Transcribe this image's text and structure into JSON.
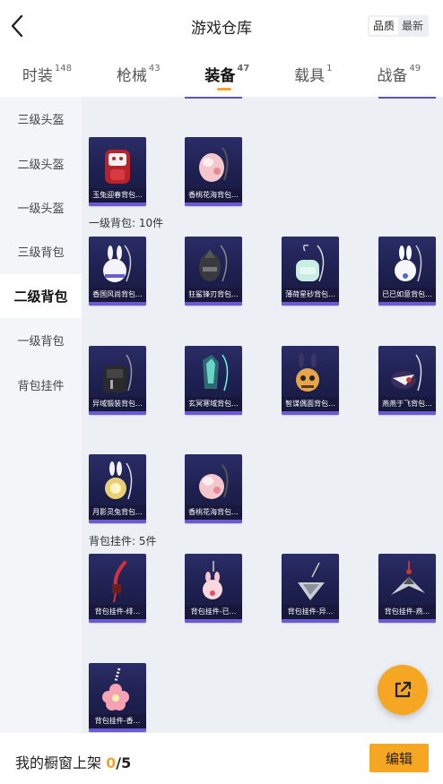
{
  "header": {
    "title": "游戏仓库",
    "sort_quality": "品质",
    "sort_newest": "最新"
  },
  "tabs": [
    {
      "label": "时装",
      "count": "148"
    },
    {
      "label": "枪械",
      "count": "43"
    },
    {
      "label": "装备",
      "count": "47",
      "active": true
    },
    {
      "label": "载具",
      "count": "1"
    },
    {
      "label": "战备",
      "count": "49"
    }
  ],
  "sidebar": [
    {
      "label": "三级头盔"
    },
    {
      "label": "二级头盔"
    },
    {
      "label": "一级头盔"
    },
    {
      "label": "三级背包"
    },
    {
      "label": "二级背包",
      "active": true
    },
    {
      "label": "一级背包"
    },
    {
      "label": "背包挂件"
    }
  ],
  "sections": [
    {
      "label": "一级背包: 10件"
    },
    {
      "label": "背包挂件: 5件"
    }
  ],
  "items": [
    {
      "caption": "玉兔迎春背包...",
      "icon": "red-white-backpack"
    },
    {
      "caption": "香桃花海背包...",
      "icon": "pink-backpack"
    },
    {
      "caption": "香国风尚背包...",
      "icon": "white-bunny-backpack"
    },
    {
      "caption": "狂鲨锋刃背包...",
      "icon": "dark-shark-backpack"
    },
    {
      "caption": "薄荷星砂背包...",
      "icon": "mint-backpack"
    },
    {
      "caption": "已已如意背包...",
      "icon": "white-rabbit-backpack"
    },
    {
      "caption": "异域锻装背包...",
      "icon": "black-armor-backpack"
    },
    {
      "caption": "玄冥寒域背包...",
      "icon": "teal-ice-backpack"
    },
    {
      "caption": "智谋偶面背包...",
      "icon": "mask-backpack"
    },
    {
      "caption": "燕燕于飞背包...",
      "icon": "swallow-backpack"
    },
    {
      "caption": "月影灵兔背包...",
      "icon": "moon-rabbit-backpack"
    },
    {
      "caption": "香桃花海背包...",
      "icon": "pink-backpack"
    },
    {
      "caption": "背包挂件-绯...",
      "icon": "red-sword-charm"
    },
    {
      "caption": "背包挂件-已...",
      "icon": "pink-rabbit-charm"
    },
    {
      "caption": "背包挂件-异...",
      "icon": "silver-pendant-charm"
    },
    {
      "caption": "背包挂件-燕...",
      "icon": "swallow-charm"
    },
    {
      "caption": "背包挂件-香...",
      "icon": "peach-blossom-charm"
    }
  ],
  "footer": {
    "label": "我的橱窗上架",
    "current": "0",
    "total": "/5",
    "edit_label": "编辑"
  },
  "colors": {
    "accent": "#f5a623",
    "card_bg": "#1d1f4e",
    "card_bar": "#6b5ad6"
  }
}
